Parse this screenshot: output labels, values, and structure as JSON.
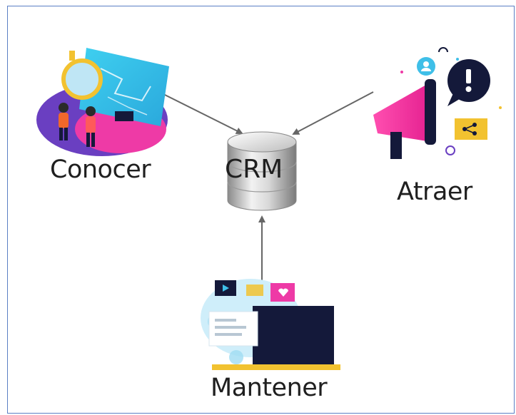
{
  "nodes": {
    "center": {
      "label": "CRM",
      "icon": "database-icon"
    },
    "conocer": {
      "label": "Conocer",
      "icon": "team-map-illustration-icon"
    },
    "atraer": {
      "label": "Atraer",
      "icon": "megaphone-illustration-icon"
    },
    "mantener": {
      "label": "Mantener",
      "icon": "monitor-social-illustration-icon"
    }
  },
  "edges": [
    {
      "from": "Conocer",
      "to": "CRM"
    },
    {
      "from": "Atraer",
      "to": "CRM"
    },
    {
      "from": "Mantener",
      "to": "CRM",
      "bidirectional": true
    }
  ],
  "colors": {
    "frame": "#5b7fc4",
    "arrow": "#666666",
    "magenta": "#ee3aa6",
    "purple": "#6a3fc1",
    "navy": "#14193a",
    "yellow": "#f2c230",
    "cyan": "#3fbfe8"
  }
}
